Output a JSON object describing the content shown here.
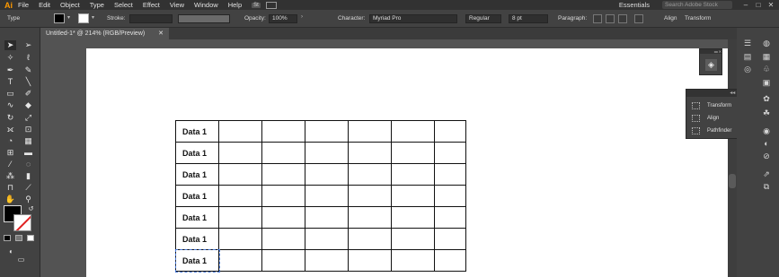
{
  "app": {
    "logo": "Ai"
  },
  "menu": [
    "File",
    "Edit",
    "Object",
    "Type",
    "Select",
    "Effect",
    "View",
    "Window",
    "Help"
  ],
  "stock_badge": "St",
  "workspace": "Essentials",
  "search": {
    "placeholder": "Search Adobe Stock"
  },
  "window_controls": {
    "minimize": "–",
    "maximize": "□",
    "close": "✕"
  },
  "control_bar": {
    "context": "Type",
    "stroke_label": "Stroke:",
    "opacity_label": "Opacity:",
    "opacity_value": "100%",
    "character_label": "Character:",
    "font_family": "Myriad Pro",
    "font_style": "Regular",
    "font_size": "8 pt",
    "paragraph_label": "Paragraph:",
    "align_label": "Align",
    "transform_label": "Transform"
  },
  "document_tab": {
    "title": "Untitled-1* @ 214% (RGB/Preview)",
    "close": "✕"
  },
  "table": {
    "rows": [
      [
        "Data 1",
        "",
        "",
        "",
        "",
        "",
        ""
      ],
      [
        "Data 1",
        "",
        "",
        "",
        "",
        "",
        ""
      ],
      [
        "Data 1",
        "",
        "",
        "",
        "",
        "",
        ""
      ],
      [
        "Data 1",
        "",
        "",
        "",
        "",
        "",
        ""
      ],
      [
        "Data 1",
        "",
        "",
        "",
        "",
        "",
        ""
      ],
      [
        "Data 1",
        "",
        "",
        "",
        "",
        "",
        ""
      ],
      [
        "Data 1",
        "",
        "",
        "",
        "",
        "",
        ""
      ]
    ]
  },
  "flyout_panel": {
    "items": [
      {
        "label": "Transform",
        "icon": "transform-icon"
      },
      {
        "label": "Align",
        "icon": "align-icon"
      },
      {
        "label": "Pathfinder",
        "icon": "pathfinder-icon"
      }
    ]
  },
  "colors": {
    "accent": "#ff9a00",
    "panel": "#424242",
    "menubar": "#323232",
    "canvas": "#535353"
  }
}
